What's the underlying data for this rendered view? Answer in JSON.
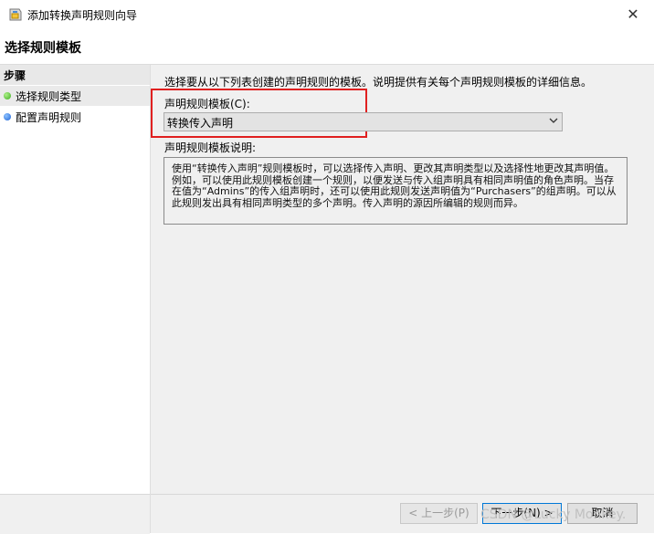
{
  "window": {
    "title": "添加转换声明规则向导",
    "close_glyph": "✕",
    "icon": "app-icon"
  },
  "header": {
    "page_title": "选择规则模板"
  },
  "sidebar": {
    "heading": "步骤",
    "steps": [
      {
        "label": "选择规则类型",
        "status_color": "#3cae1f",
        "current": true
      },
      {
        "label": "配置声明规则",
        "status_color": "#1d62d6",
        "current": false
      }
    ]
  },
  "main": {
    "intro": "选择要从以下列表创建的声明规则的模板。说明提供有关每个声明规则模板的详细信息。",
    "template_label": "声明规则模板(C):",
    "template_value": "转换传入声明",
    "description_label": "声明规则模板说明:",
    "description_text": "使用“转换传入声明”规则模板时，可以选择传入声明、更改其声明类型以及选择性地更改其声明值。例如，可以使用此规则模板创建一个规则，以便发送与传入组声明具有相同声明值的角色声明。当存在值为“Admins”的传入组声明时，还可以使用此规则发送声明值为“Purchasers”的组声明。可以从此规则发出具有相同声明类型的多个声明。传入声明的源因所编辑的规则而异。"
  },
  "buttons": {
    "back": "< 上一步(P)",
    "next": "下一步(N) >",
    "cancel": "取消"
  },
  "watermark": "CSDN @Lucky Monkey."
}
